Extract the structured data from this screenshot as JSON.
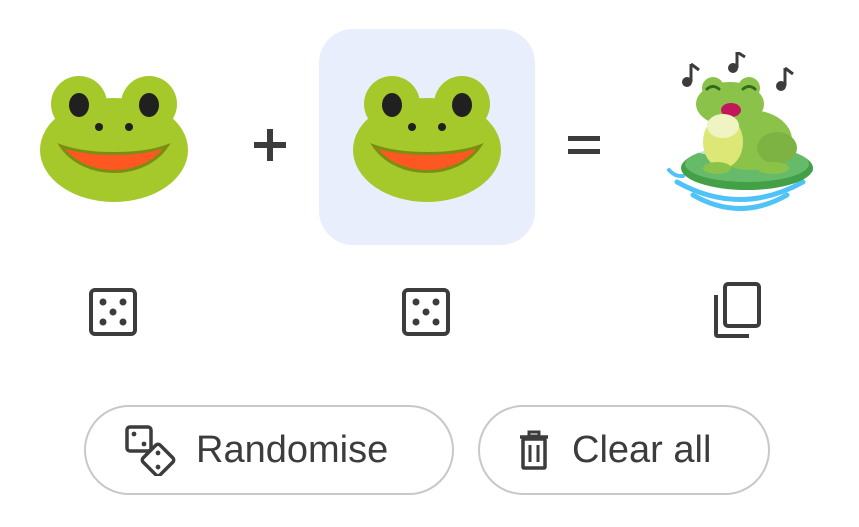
{
  "kitchen": {
    "left_emoji": {
      "icon": "frog-face-icon"
    },
    "operator_plus": "+",
    "right_emoji": {
      "icon": "frog-face-icon",
      "selected": true
    },
    "operator_equals": "=",
    "result_emoji": {
      "icon": "singing-frog-on-lily-pad-icon"
    }
  },
  "controls": {
    "left_random_icon": "dice-icon",
    "right_random_icon": "dice-icon",
    "result_copy_icon": "copy-icon"
  },
  "buttons": {
    "randomise_label": "Randomise",
    "randomise_icon": "dice-pair-icon",
    "clear_label": "Clear all",
    "clear_icon": "trash-icon"
  },
  "colors": {
    "selected_bg": "#e8eefb",
    "frog_green": "#a5c82a",
    "mouth_orange": "#ff5722",
    "icon_dark": "#3c3c3c",
    "pill_border": "#c8c8c8"
  }
}
